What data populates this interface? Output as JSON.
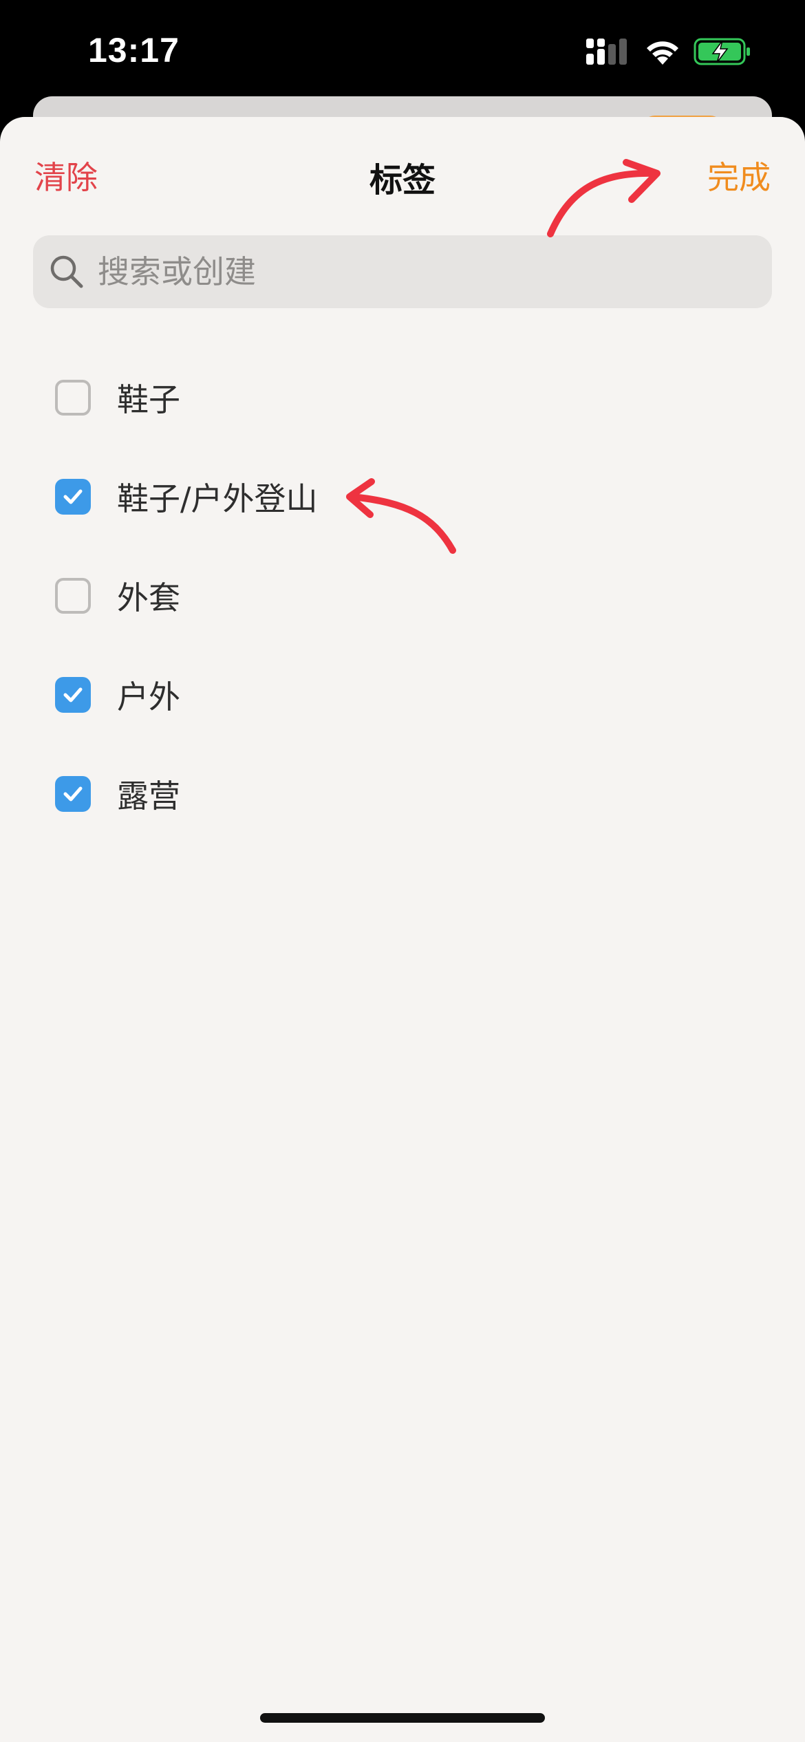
{
  "status_bar": {
    "time": "13:17",
    "icons": [
      "signal-icon",
      "wifi-icon",
      "battery-charging-icon"
    ],
    "battery_color": "#34c759"
  },
  "nav": {
    "clear_label": "清除",
    "title": "标签",
    "done_label": "完成"
  },
  "search": {
    "placeholder": "搜索或创建",
    "value": ""
  },
  "tags": [
    {
      "label": "鞋子",
      "checked": false
    },
    {
      "label": "鞋子/户外登山",
      "checked": true
    },
    {
      "label": "外套",
      "checked": false
    },
    {
      "label": "户外",
      "checked": true
    },
    {
      "label": "露营",
      "checked": true
    }
  ],
  "colors": {
    "clear": "#e2434a",
    "done": "#f08c1e",
    "checkbox_checked": "#3d9ae8",
    "annotation_arrow": "#ee3340"
  }
}
